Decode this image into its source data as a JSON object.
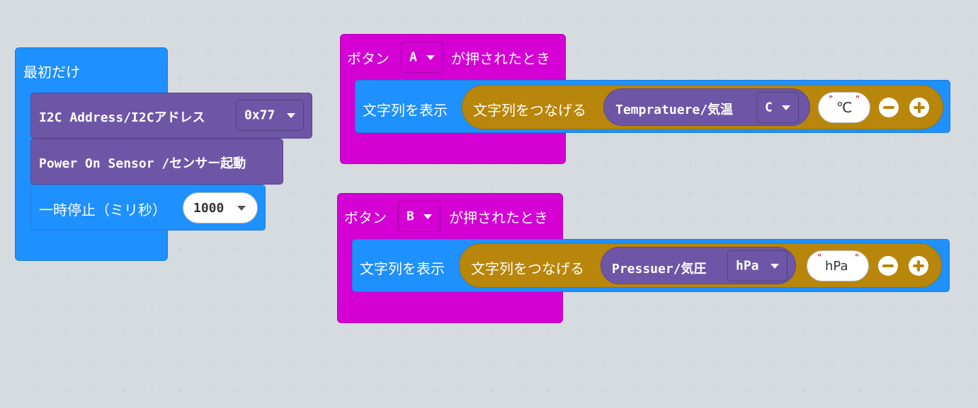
{
  "start_block": {
    "title": "最初だけ",
    "i2c_label": "I2C Address/I2Cアドレス",
    "i2c_value": "0x77",
    "power_label": "Power On Sensor /センサー起動",
    "pause_label": "一時停止（ミリ秒）",
    "pause_value": "1000"
  },
  "button_a_block": {
    "prefix": "ボタン",
    "button_value": "A",
    "suffix": "が押されたとき",
    "show_label": "文字列を表示",
    "join_label": "文字列をつなげる",
    "sensor_label": "Tempratuere/気温",
    "unit_value": "C",
    "string_value": "℃"
  },
  "button_b_block": {
    "prefix": "ボタン",
    "button_value": "B",
    "suffix": "が押されたとき",
    "show_label": "文字列を表示",
    "join_label": "文字列をつなげる",
    "sensor_label": "Pressuer/気圧",
    "unit_value": "hPa",
    "string_value": "hPa"
  },
  "colors": {
    "background": "#ecf0f1",
    "basic_blue": "#1e90ff",
    "sensor_purple": "#6e56a6",
    "input_magenta": "#d400d4",
    "text_gold": "#b8860b"
  }
}
